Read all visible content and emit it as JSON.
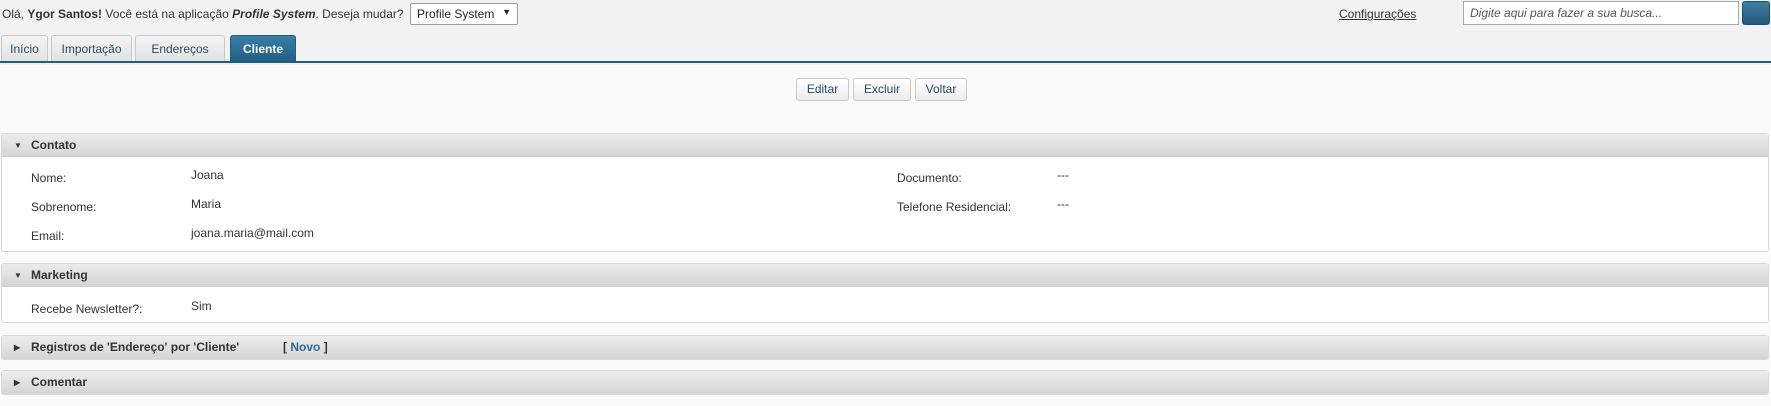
{
  "header": {
    "greeting_prefix": "Olá,",
    "user_name": "Ygor Santos!",
    "app_text": "Você está na aplicação",
    "app_name": "Profile System",
    "change_text": ". Deseja mudar?",
    "app_select_value": "Profile System",
    "config_label": "Configurações",
    "search_placeholder": "Digite aqui para fazer a sua busca..."
  },
  "tabs": [
    {
      "label": "Início",
      "active": false
    },
    {
      "label": "Importação",
      "active": false
    },
    {
      "label": "Endereços",
      "active": false
    },
    {
      "label": "Cliente",
      "active": true
    }
  ],
  "actions": {
    "edit_label": "Editar",
    "delete_label": "Excluir",
    "back_label": "Voltar"
  },
  "contato": {
    "title": "Contato",
    "fields": [
      {
        "label": "Nome:",
        "value": "Joana"
      },
      {
        "label": "Sobrenome:",
        "value": "Maria"
      },
      {
        "label": "Email:",
        "value": "joana.maria@mail.com"
      },
      {
        "label": "Documento:",
        "value": "---"
      },
      {
        "label": "Telefone Residencial:",
        "value": "---"
      }
    ]
  },
  "marketing": {
    "title": "Marketing",
    "fields": [
      {
        "label": "Recebe Newsletter?:",
        "value": "Sim"
      }
    ]
  },
  "registros": {
    "title": "Registros de 'Endereço' por 'Cliente'",
    "bracket_open": "[",
    "novo_label": "Novo",
    "bracket_close": "]"
  },
  "comentar": {
    "title": "Comentar"
  },
  "colors": {
    "accent": "#1f5e82",
    "link": "#2a6a9a"
  }
}
